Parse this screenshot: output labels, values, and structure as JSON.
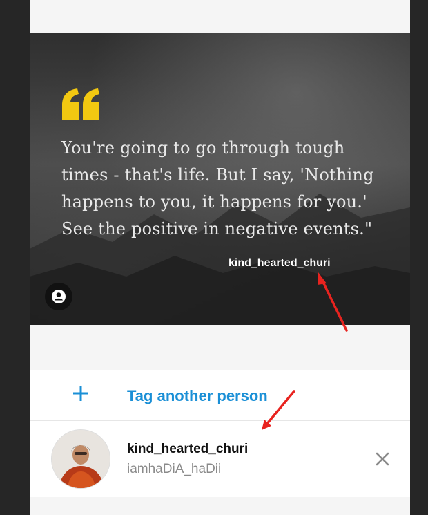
{
  "photo": {
    "quote_lines": [
      "You're going to go through tough",
      "times - that's life. But I say, 'Nothing",
      "happens to you, it happens for you.'",
      "See the positive in negative events.\""
    ],
    "tag_username": "kind_hearted_churi",
    "quote_color": "#f2c811"
  },
  "tag_another": {
    "label": "Tag another person",
    "icon": "plus-icon",
    "color": "#1a8fd6"
  },
  "tagged_person": {
    "username": "kind_hearted_churi",
    "display_name": "iamhaDiA_haDii",
    "remove_icon": "close-icon"
  },
  "annotation_color": "#e8231f"
}
